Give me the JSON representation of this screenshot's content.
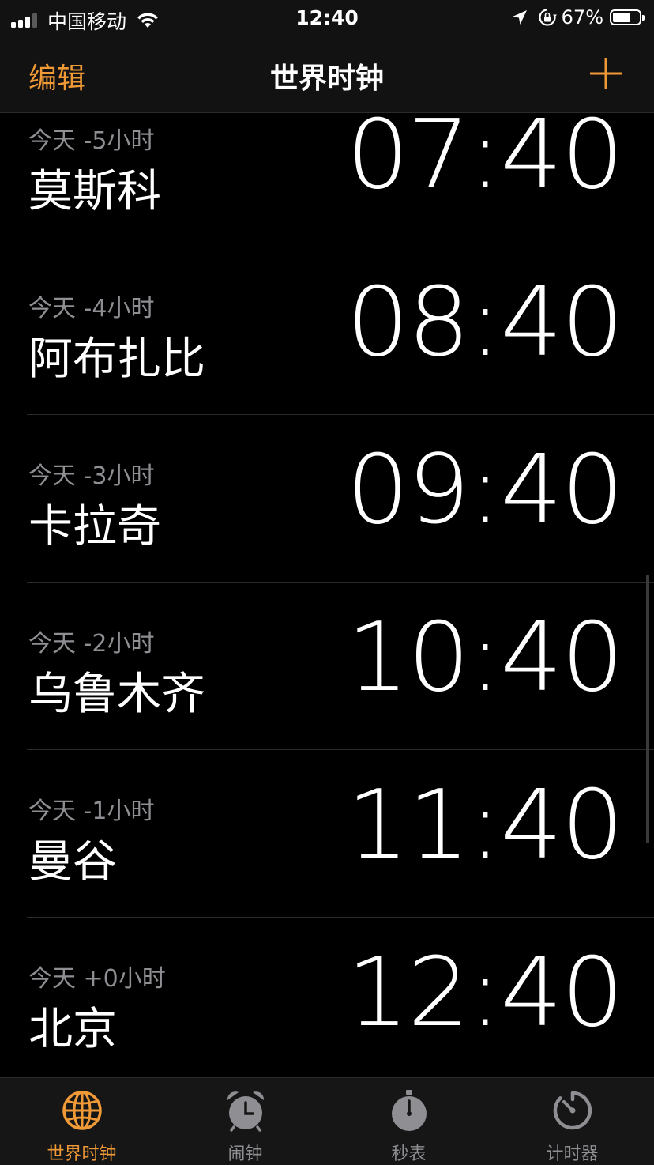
{
  "status_bar": {
    "carrier": "中国移动",
    "time": "12:40",
    "battery": "67%",
    "icons": [
      "signal-icon",
      "wifi-icon",
      "location-icon",
      "orientation-lock-icon",
      "battery-icon"
    ]
  },
  "nav": {
    "edit": "编辑",
    "title": "世界时钟",
    "add_icon": "plus-icon"
  },
  "colors": {
    "accent": "#f09a37",
    "background": "#000000",
    "secondary_text": "#8e8e93"
  },
  "clocks": [
    {
      "offset": "今天 -5小时",
      "city": "莫斯科",
      "time": "07:40"
    },
    {
      "offset": "今天 -4小时",
      "city": "阿布扎比",
      "time": "08:40"
    },
    {
      "offset": "今天 -3小时",
      "city": "卡拉奇",
      "time": "09:40"
    },
    {
      "offset": "今天 -2小时",
      "city": "乌鲁木齐",
      "time": "10:40"
    },
    {
      "offset": "今天 -1小时",
      "city": "曼谷",
      "time": "11:40"
    },
    {
      "offset": "今天 +0小时",
      "city": "北京",
      "time": "12:40"
    }
  ],
  "tabs": [
    {
      "label": "世界时钟",
      "icon": "globe-icon",
      "active": true
    },
    {
      "label": "闹钟",
      "icon": "alarm-clock-icon",
      "active": false
    },
    {
      "label": "秒表",
      "icon": "stopwatch-icon",
      "active": false
    },
    {
      "label": "计时器",
      "icon": "timer-icon",
      "active": false
    }
  ]
}
